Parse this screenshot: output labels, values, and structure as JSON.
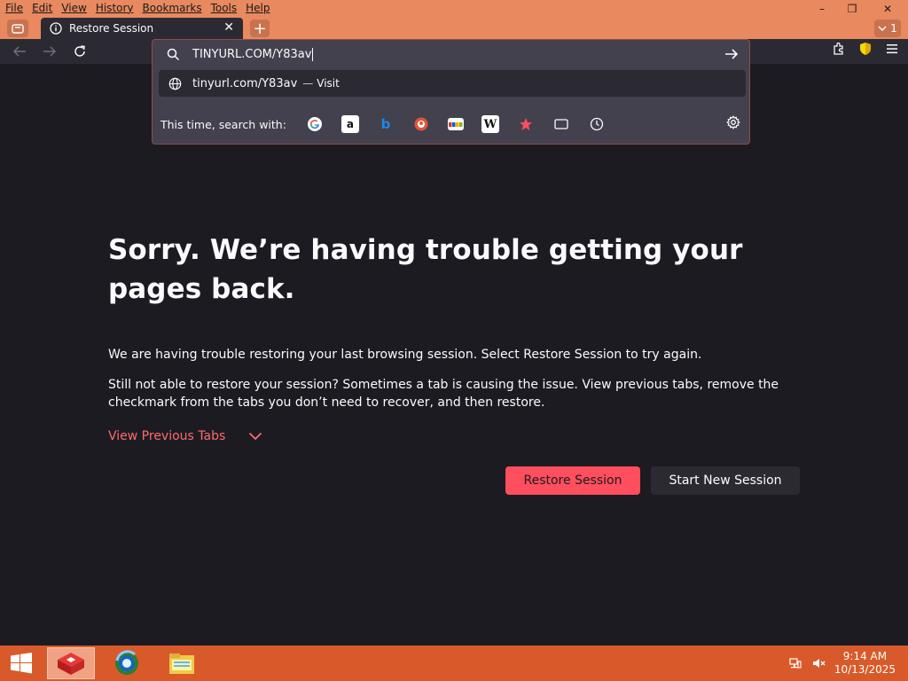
{
  "menu": [
    "File",
    "Edit",
    "View",
    "History",
    "Bookmarks",
    "Tools",
    "Help"
  ],
  "window": {
    "min": "–",
    "restore": "❐",
    "close": "✕"
  },
  "tab": {
    "title": "Restore Session",
    "close": "✕"
  },
  "tablist_count": "1",
  "urlbar": {
    "text": "TINYURL.COM/Y83av"
  },
  "suggestion": {
    "url": "tinyurl.com/Y83av",
    "sep": "—",
    "action": "Visit"
  },
  "search_with": {
    "label": "This time, search with:"
  },
  "content": {
    "title": "Sorry. We’re having trouble getting your pages back.",
    "p1": "We are having trouble restoring your last browsing session. Select Restore Session to try again.",
    "p2": "Still not able to restore your session? Sometimes a tab is causing the issue. View previous tabs, remove the checkmark from the tabs you don’t need to recover, and then restore.",
    "view_previous": "View Previous Tabs",
    "restore_btn": "Restore Session",
    "new_btn": "Start New Session"
  },
  "taskbar": {
    "time": "9:14 AM",
    "date": "10/13/2025"
  },
  "colors": {
    "accent": "#ff4f5e",
    "titlebar": "#e8895f",
    "taskbar": "#d85a2a",
    "page_bg": "#1c1b22"
  }
}
